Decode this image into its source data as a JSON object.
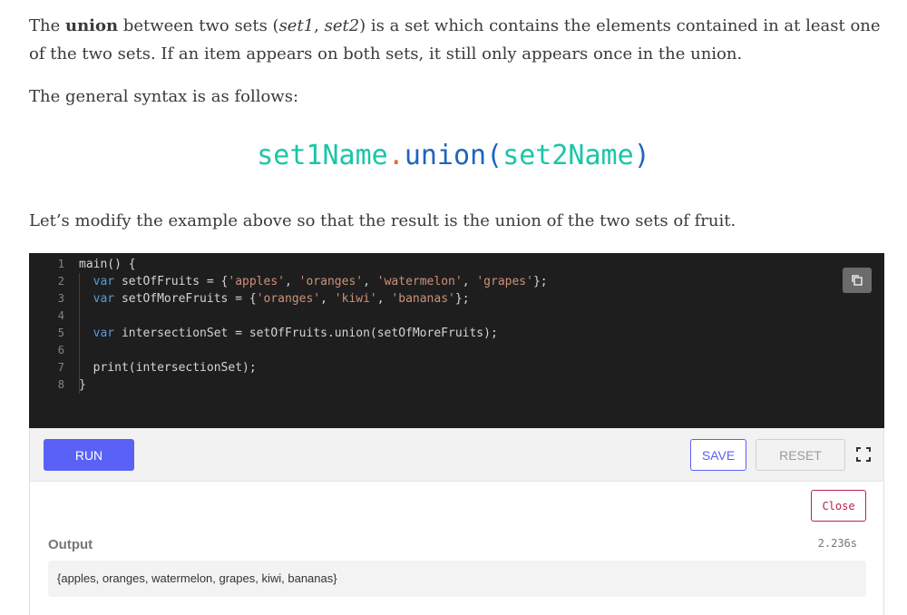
{
  "intro": {
    "p1_a": "The ",
    "p1_bold": "union",
    "p1_b": " between two sets (",
    "p1_set1": "set1",
    "p1_c": ", ",
    "p1_set2": "set2",
    "p1_d": ") is a set which contains the elements contained in at least one of the two sets. If an item appears on both sets, it still only appears once in the union.",
    "p2": "The general syntax is as follows:",
    "p3": "Let’s modify the example above so that the result is the union of the two sets of fruit."
  },
  "syntax": {
    "set1": "set1Name",
    "dot": ".",
    "method": "union",
    "open": "(",
    "set2": "set2Name",
    "close": ")"
  },
  "editor": {
    "line_numbers": [
      "1",
      "2",
      "3",
      "4",
      "5",
      "6",
      "7",
      "8"
    ],
    "lines": [
      {
        "indent": "",
        "parts": [
          {
            "t": "main() {",
            "c": ""
          }
        ]
      },
      {
        "indent": "  ",
        "parts": [
          {
            "t": "var",
            "c": "kw"
          },
          {
            "t": " setOfFruits = {",
            "c": ""
          },
          {
            "t": "'apples'",
            "c": "str"
          },
          {
            "t": ", ",
            "c": ""
          },
          {
            "t": "'oranges'",
            "c": "str"
          },
          {
            "t": ", ",
            "c": ""
          },
          {
            "t": "'watermelon'",
            "c": "str"
          },
          {
            "t": ", ",
            "c": ""
          },
          {
            "t": "'grapes'",
            "c": "str"
          },
          {
            "t": "};",
            "c": ""
          }
        ]
      },
      {
        "indent": "  ",
        "parts": [
          {
            "t": "var",
            "c": "kw"
          },
          {
            "t": " setOfMoreFruits = {",
            "c": ""
          },
          {
            "t": "'oranges'",
            "c": "str"
          },
          {
            "t": ", ",
            "c": ""
          },
          {
            "t": "'kiwi'",
            "c": "str"
          },
          {
            "t": ", ",
            "c": ""
          },
          {
            "t": "'bananas'",
            "c": "str"
          },
          {
            "t": "};",
            "c": ""
          }
        ]
      },
      {
        "indent": "",
        "parts": []
      },
      {
        "indent": "  ",
        "parts": [
          {
            "t": "var",
            "c": "kw"
          },
          {
            "t": " intersectionSet = setOfFruits.union(setOfMoreFruits);",
            "c": ""
          }
        ]
      },
      {
        "indent": "",
        "parts": []
      },
      {
        "indent": "  ",
        "parts": [
          {
            "t": "print(intersectionSet);",
            "c": ""
          }
        ]
      },
      {
        "indent": "",
        "parts": [
          {
            "t": "}",
            "c": ""
          }
        ]
      }
    ]
  },
  "toolbar": {
    "run_label": "RUN",
    "save_label": "SAVE",
    "reset_label": "RESET"
  },
  "output": {
    "close_label": "Close",
    "label": "Output",
    "timing": "2.236s",
    "text": "{apples, oranges, watermelon, grapes, kiwi, bananas}"
  }
}
